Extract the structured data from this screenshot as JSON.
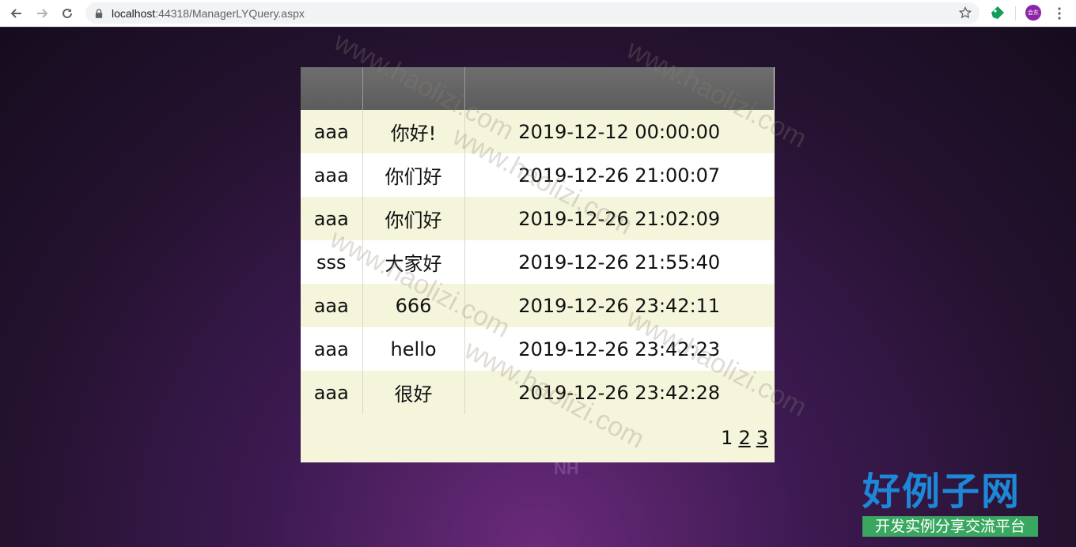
{
  "browser": {
    "url_host": "localhost",
    "url_rest": ":44318/ManagerLYQuery.aspx",
    "avatar_text": "会东",
    "icons": [
      "back-icon",
      "forward-icon",
      "reload-icon",
      "lock-icon",
      "star-icon",
      "extension-icon",
      "menu-icon"
    ]
  },
  "table": {
    "headers": [
      "",
      "",
      ""
    ],
    "rows": [
      {
        "user": "aaa",
        "message": "你好!",
        "time": "2019-12-12 00:00:00"
      },
      {
        "user": "aaa",
        "message": "你们好",
        "time": "2019-12-26 21:00:07"
      },
      {
        "user": "aaa",
        "message": "你们好",
        "time": "2019-12-26 21:02:09"
      },
      {
        "user": "sss",
        "message": "大家好",
        "time": "2019-12-26 21:55:40"
      },
      {
        "user": "aaa",
        "message": "666",
        "time": "2019-12-26 23:42:11"
      },
      {
        "user": "aaa",
        "message": "hello",
        "time": "2019-12-26 23:42:23"
      },
      {
        "user": "aaa",
        "message": "很好",
        "time": "2019-12-26 23:42:28"
      }
    ]
  },
  "pager": {
    "current": "1",
    "pages": [
      "2",
      "3"
    ]
  },
  "page_deco": "NH",
  "watermark": "www.haolizi.com",
  "logo": {
    "main": "好例子网",
    "sub": "开发实例分享交流平台"
  },
  "colors": {
    "header_bg": "#666666",
    "row_odd": "#f5f5dc",
    "row_even": "#ffffff",
    "logo_blue": "#1e88d8",
    "logo_green": "#3aa760"
  }
}
